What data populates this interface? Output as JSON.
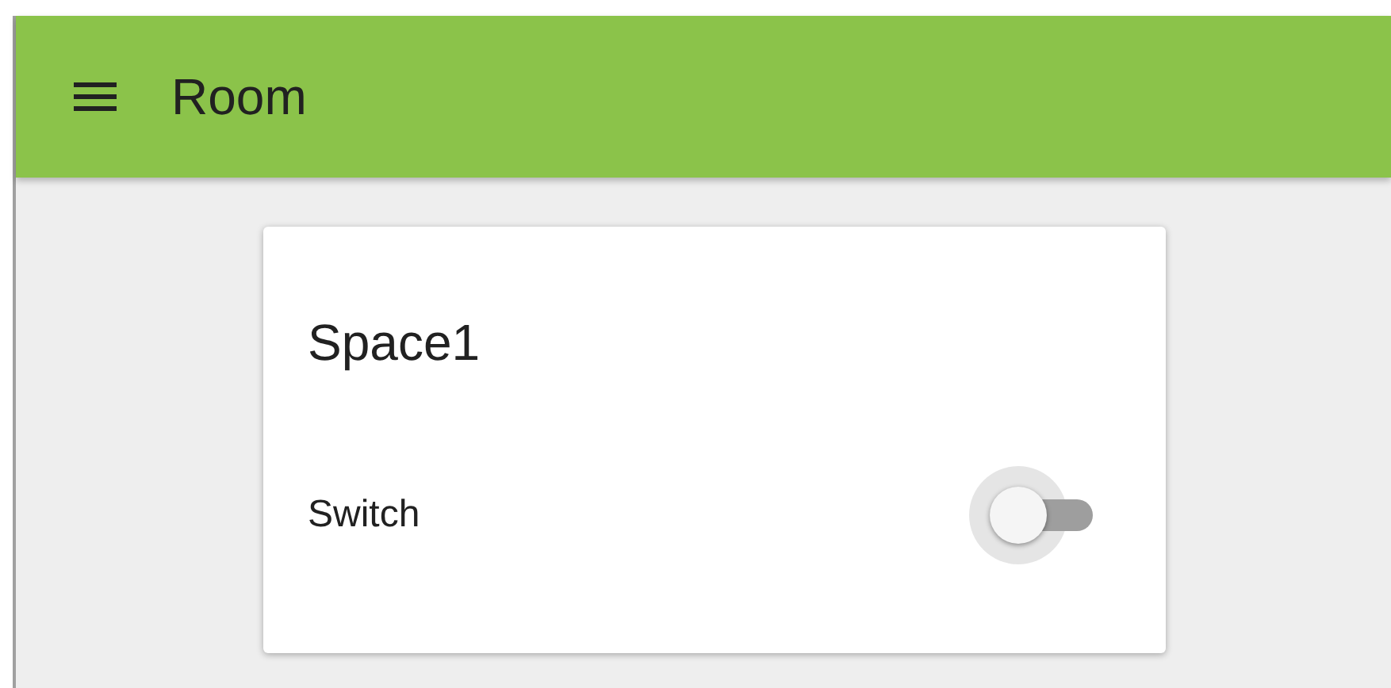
{
  "header": {
    "title": "Room"
  },
  "cards": [
    {
      "title": "Space1",
      "rows": [
        {
          "kind": "toggle",
          "label": "Switch",
          "on": false
        }
      ]
    }
  ]
}
